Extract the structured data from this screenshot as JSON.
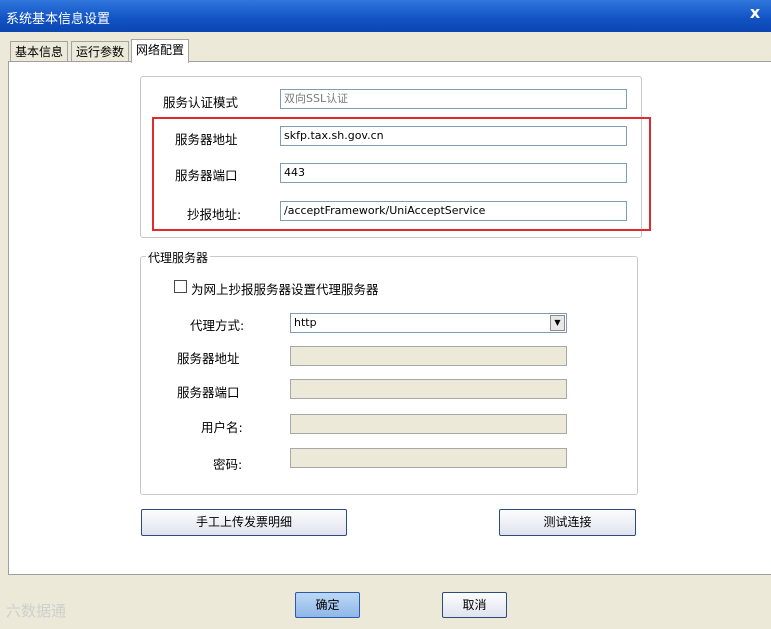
{
  "window": {
    "title": "系统基本信息设置",
    "close_glyph": "x"
  },
  "tabs": [
    {
      "label": "基本信息",
      "active": false
    },
    {
      "label": "运行参数",
      "active": false
    },
    {
      "label": "网络配置",
      "active": true
    }
  ],
  "server_settings": {
    "auth_mode_label": "服务认证模式",
    "auth_mode_value": "双向SSL认证",
    "address_label": "服务器地址",
    "address_value": "skfp.tax.sh.gov.cn",
    "port_label": "服务器端口",
    "port_value": "443",
    "report_address_label": "抄报地址:",
    "report_address_value": "/acceptFramework/UniAcceptService"
  },
  "proxy": {
    "group_title": "代理服务器",
    "checkbox_label": "为网上抄报服务器设置代理服务器",
    "checkbox_checked": false,
    "method_label": "代理方式:",
    "method_value": "http",
    "address_label": "服务器地址",
    "address_value": "",
    "port_label": "服务器端口",
    "port_value": "",
    "username_label": "用户名:",
    "username_value": "",
    "password_label": "密码:",
    "password_value": ""
  },
  "buttons": {
    "upload_label": "手工上传发票明细",
    "test_label": "测试连接",
    "ok_label": "确定",
    "cancel_label": "取消"
  },
  "watermark": "六数据通",
  "colors": {
    "titlebar": "#1152c3",
    "highlight_box": "#e2292e"
  }
}
